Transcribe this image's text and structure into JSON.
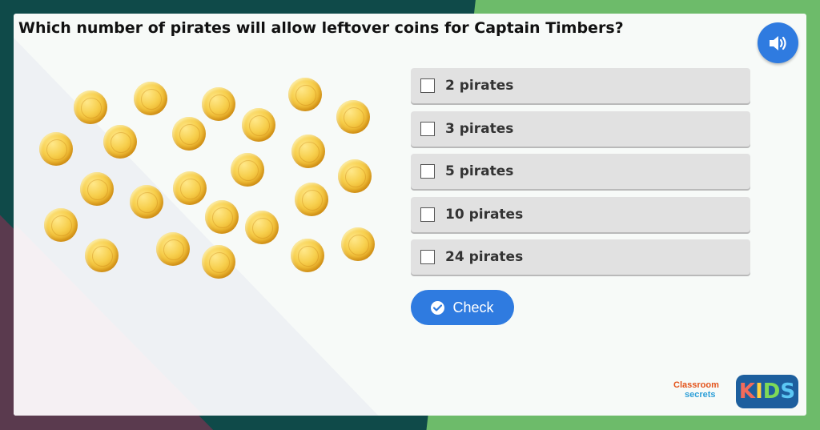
{
  "question": "Which number of pirates will allow leftover coins for Captain Timbers?",
  "audio_icon": "speaker-icon",
  "coins": {
    "count": 24,
    "icon": "gold-coin-icon"
  },
  "options": [
    {
      "label": "2 pirates",
      "checked": false
    },
    {
      "label": "3 pirates",
      "checked": false
    },
    {
      "label": "5 pirates",
      "checked": false
    },
    {
      "label": "10 pirates",
      "checked": false
    },
    {
      "label": "24 pirates",
      "checked": false
    }
  ],
  "check_button": {
    "label": "Check",
    "icon": "check-circle-icon"
  },
  "logos": {
    "classroom_secrets_top": "Classroom",
    "classroom_secrets_bottom": "secrets",
    "kids_letters": [
      "K",
      "I",
      "D",
      "S"
    ]
  },
  "colors": {
    "accent": "#2f7be0",
    "background_green": "#6dbb6a",
    "option_bg": "#e1e1e1"
  }
}
